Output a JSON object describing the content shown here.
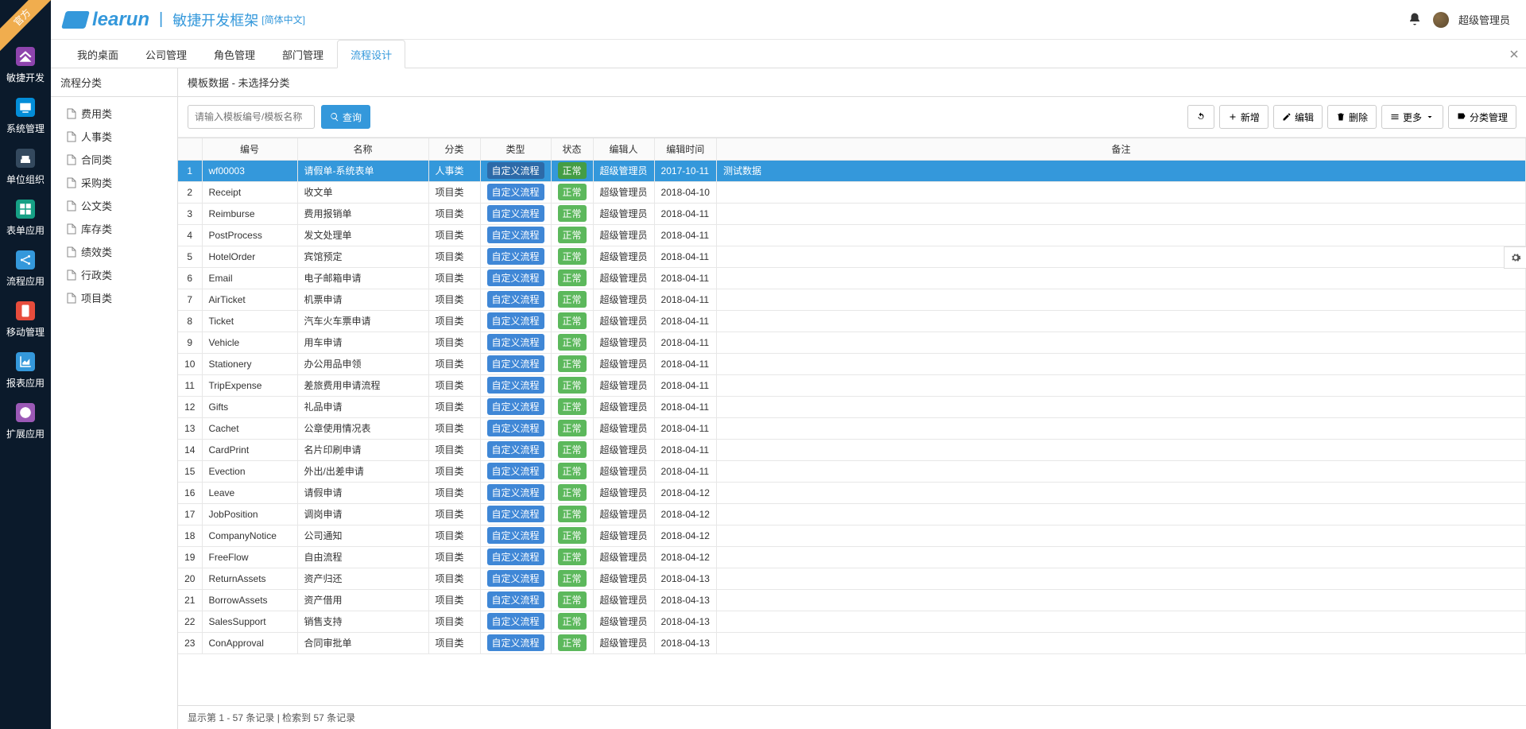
{
  "ribbon": "官方",
  "brand": {
    "name": "learun",
    "subtitle": "敏捷开发框架",
    "lang": "[简体中文]"
  },
  "header": {
    "username": "超级管理员"
  },
  "rail": [
    {
      "label": "敏捷开发",
      "style": "ragile"
    },
    {
      "label": "系统管理",
      "style": "cyan"
    },
    {
      "label": "单位组织",
      "style": "navy"
    },
    {
      "label": "表单应用",
      "style": "teal"
    },
    {
      "label": "流程应用",
      "style": "blue"
    },
    {
      "label": "移动管理",
      "style": "red"
    },
    {
      "label": "报表应用",
      "style": "blue"
    },
    {
      "label": "扩展应用",
      "style": "purple"
    }
  ],
  "tabs": {
    "items": [
      "我的桌面",
      "公司管理",
      "角色管理",
      "部门管理",
      "流程设计"
    ],
    "active": 4
  },
  "sidebar": {
    "title": "流程分类",
    "items": [
      "费用类",
      "人事类",
      "合同类",
      "采购类",
      "公文类",
      "库存类",
      "绩效类",
      "行政类",
      "项目类"
    ]
  },
  "content": {
    "title": "模板数据 - 未选择分类",
    "search_placeholder": "请输入模板编号/模板名称",
    "btn_search": "查询",
    "btn_add": "新增",
    "btn_edit": "编辑",
    "btn_delete": "删除",
    "btn_more": "更多",
    "btn_category": "分类管理"
  },
  "table": {
    "headers": [
      "",
      "编号",
      "名称",
      "分类",
      "类型",
      "状态",
      "编辑人",
      "编辑时间",
      "备注"
    ],
    "type_label": "自定义流程",
    "status_label": "正常",
    "rows": [
      {
        "n": 1,
        "code": "wf00003",
        "name": "请假单-系统表单",
        "cat": "人事类",
        "editor": "超级管理员",
        "time": "2017-10-11",
        "remark": "测试数据",
        "selected": true
      },
      {
        "n": 2,
        "code": "Receipt",
        "name": "收文单",
        "cat": "项目类",
        "editor": "超级管理员",
        "time": "2018-04-10",
        "remark": ""
      },
      {
        "n": 3,
        "code": "Reimburse",
        "name": "费用报销单",
        "cat": "项目类",
        "editor": "超级管理员",
        "time": "2018-04-11",
        "remark": ""
      },
      {
        "n": 4,
        "code": "PostProcess",
        "name": "发文处理单",
        "cat": "项目类",
        "editor": "超级管理员",
        "time": "2018-04-11",
        "remark": ""
      },
      {
        "n": 5,
        "code": "HotelOrder",
        "name": "宾馆预定",
        "cat": "项目类",
        "editor": "超级管理员",
        "time": "2018-04-11",
        "remark": ""
      },
      {
        "n": 6,
        "code": "Email",
        "name": "电子邮箱申请",
        "cat": "项目类",
        "editor": "超级管理员",
        "time": "2018-04-11",
        "remark": ""
      },
      {
        "n": 7,
        "code": "AirTicket",
        "name": "机票申请",
        "cat": "项目类",
        "editor": "超级管理员",
        "time": "2018-04-11",
        "remark": ""
      },
      {
        "n": 8,
        "code": "Ticket",
        "name": "汽车火车票申请",
        "cat": "项目类",
        "editor": "超级管理员",
        "time": "2018-04-11",
        "remark": ""
      },
      {
        "n": 9,
        "code": "Vehicle",
        "name": "用车申请",
        "cat": "项目类",
        "editor": "超级管理员",
        "time": "2018-04-11",
        "remark": ""
      },
      {
        "n": 10,
        "code": "Stationery",
        "name": "办公用品申领",
        "cat": "项目类",
        "editor": "超级管理员",
        "time": "2018-04-11",
        "remark": ""
      },
      {
        "n": 11,
        "code": "TripExpense",
        "name": "差旅费用申请流程",
        "cat": "项目类",
        "editor": "超级管理员",
        "time": "2018-04-11",
        "remark": ""
      },
      {
        "n": 12,
        "code": "Gifts",
        "name": "礼品申请",
        "cat": "项目类",
        "editor": "超级管理员",
        "time": "2018-04-11",
        "remark": ""
      },
      {
        "n": 13,
        "code": "Cachet",
        "name": "公章使用情况表",
        "cat": "项目类",
        "editor": "超级管理员",
        "time": "2018-04-11",
        "remark": ""
      },
      {
        "n": 14,
        "code": "CardPrint",
        "name": "名片印刷申请",
        "cat": "项目类",
        "editor": "超级管理员",
        "time": "2018-04-11",
        "remark": ""
      },
      {
        "n": 15,
        "code": "Evection",
        "name": "外出/出差申请",
        "cat": "项目类",
        "editor": "超级管理员",
        "time": "2018-04-11",
        "remark": ""
      },
      {
        "n": 16,
        "code": "Leave",
        "name": "请假申请",
        "cat": "项目类",
        "editor": "超级管理员",
        "time": "2018-04-12",
        "remark": ""
      },
      {
        "n": 17,
        "code": "JobPosition",
        "name": "调岗申请",
        "cat": "项目类",
        "editor": "超级管理员",
        "time": "2018-04-12",
        "remark": ""
      },
      {
        "n": 18,
        "code": "CompanyNotice",
        "name": "公司通知",
        "cat": "项目类",
        "editor": "超级管理员",
        "time": "2018-04-12",
        "remark": ""
      },
      {
        "n": 19,
        "code": "FreeFlow",
        "name": "自由流程",
        "cat": "项目类",
        "editor": "超级管理员",
        "time": "2018-04-12",
        "remark": ""
      },
      {
        "n": 20,
        "code": "ReturnAssets",
        "name": "资产归还",
        "cat": "项目类",
        "editor": "超级管理员",
        "time": "2018-04-13",
        "remark": ""
      },
      {
        "n": 21,
        "code": "BorrowAssets",
        "name": "资产借用",
        "cat": "项目类",
        "editor": "超级管理员",
        "time": "2018-04-13",
        "remark": ""
      },
      {
        "n": 22,
        "code": "SalesSupport",
        "name": "销售支持",
        "cat": "项目类",
        "editor": "超级管理员",
        "time": "2018-04-13",
        "remark": ""
      },
      {
        "n": 23,
        "code": "ConApproval",
        "name": "合同审批单",
        "cat": "项目类",
        "editor": "超级管理员",
        "time": "2018-04-13",
        "remark": ""
      }
    ]
  },
  "footer": "显示第 1 - 57 条记录 | 检索到 57 条记录"
}
